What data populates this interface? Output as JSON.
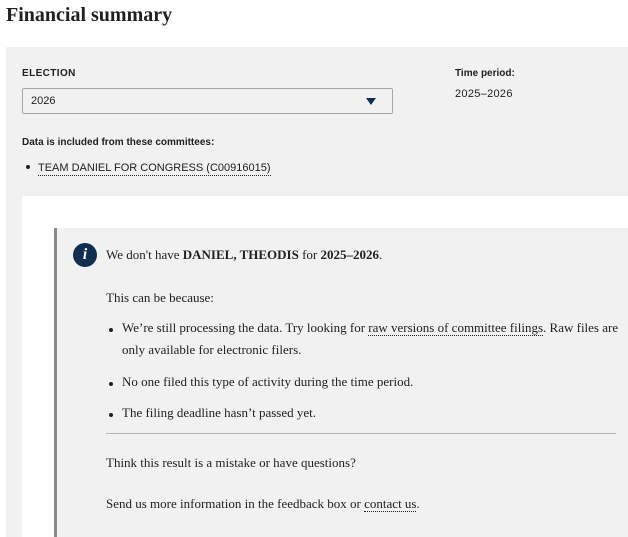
{
  "page_title": "Financial summary",
  "filters": {
    "election_label": "ELECTION",
    "election_value": "2026",
    "time_period_label": "Time period:",
    "time_period_value": "2025–2026",
    "committees_label": "Data is included from these committees:",
    "committees": [
      {
        "name": "TEAM DANIEL FOR CONGRESS (C00916015)"
      }
    ]
  },
  "notice": {
    "icon": "info-icon",
    "icon_glyph": "i",
    "line1_prefix": "We don't have ",
    "candidate": "DANIEL, THEODIS",
    "line1_mid": " for ",
    "period": "2025–2026",
    "line1_suffix": ".",
    "reasons_intro": "This can be because:",
    "reason1_prefix": "We’re still processing the data. Try looking for ",
    "reason1_link": "raw versions of committee filings",
    "reason1_suffix": ". Raw files are only available for electronic filers.",
    "reason2": "No one filed this type of activity during the time period.",
    "reason3": "The filing deadline hasn’t passed yet.",
    "question": "Think this result is a mistake or have questions?",
    "send_prefix": "Send us more information in the feedback box or ",
    "contact_link": "contact us",
    "send_suffix": "."
  },
  "colors": {
    "panel_bg": "#f1f1f1",
    "icon_bg": "#112e51",
    "caret": "#112e51"
  }
}
